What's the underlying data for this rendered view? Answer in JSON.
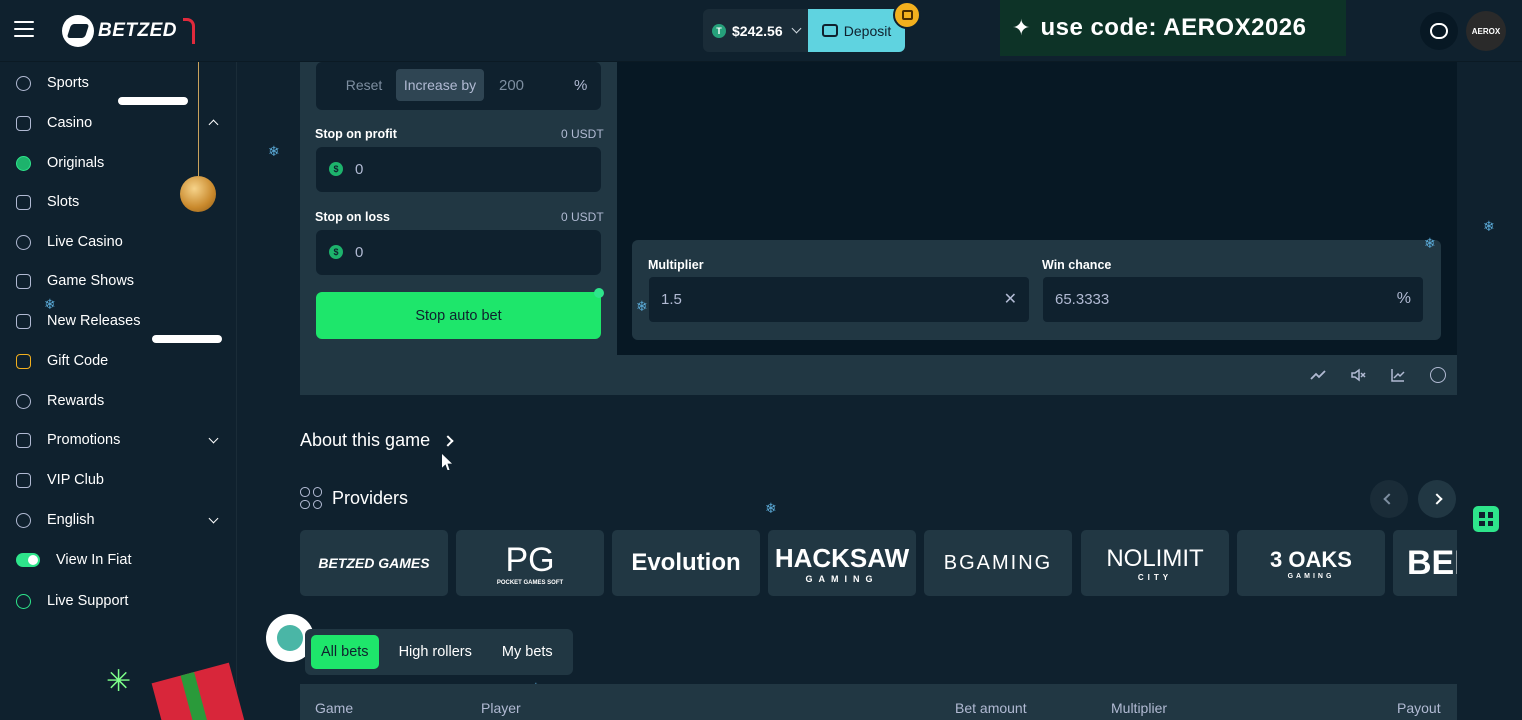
{
  "header": {
    "logo_text": "BETZED",
    "balance": "$242.56",
    "currency_icon": "T",
    "deposit_label": "Deposit",
    "promo_text": "use code: AEROX2026",
    "avatar_text": "AEROX"
  },
  "sidebar": {
    "items": [
      {
        "label": "Sports",
        "icon": "basketball-icon"
      },
      {
        "label": "Casino",
        "icon": "casino-icon"
      },
      {
        "label": "Originals",
        "icon": "originals-icon"
      },
      {
        "label": "Slots",
        "icon": "slot-machine-icon"
      },
      {
        "label": "Live Casino",
        "icon": "live-icon"
      },
      {
        "label": "Game Shows",
        "icon": "pen-icon"
      },
      {
        "label": "New Releases",
        "icon": "document-icon"
      },
      {
        "label": "Gift Code",
        "icon": "gift-icon"
      },
      {
        "label": "Rewards",
        "icon": "rewards-icon"
      },
      {
        "label": "Promotions",
        "icon": "promotions-icon"
      },
      {
        "label": "VIP Club",
        "icon": "crown-icon"
      },
      {
        "label": "English",
        "icon": "globe-icon"
      },
      {
        "label": "View In Fiat",
        "icon": "toggle-icon"
      },
      {
        "label": "Live Support",
        "icon": "headset-icon"
      }
    ]
  },
  "autobet": {
    "reset_label": "Reset",
    "increase_label": "Increase by",
    "increase_value": "200",
    "percent": "%",
    "stop_profit_label": "Stop on profit",
    "stop_profit_currency": "0 USDT",
    "stop_profit_value": "0",
    "stop_loss_label": "Stop on loss",
    "stop_loss_currency": "0 USDT",
    "stop_loss_value": "0",
    "stop_button": "Stop auto bet"
  },
  "game": {
    "multiplier_label": "Multiplier",
    "multiplier_value": "1.5",
    "win_chance_label": "Win chance",
    "win_chance_value": "65.3333",
    "percent": "%"
  },
  "about_label": "About this game",
  "providers": {
    "title": "Providers",
    "items": [
      "BETZED GAMES",
      "PG",
      "Evolution",
      "HACKSAW",
      "BGAMING",
      "NOLIMIT",
      "3 OAKS",
      "BEL"
    ],
    "subtitles": [
      "",
      "POCKET GAMES SOFT",
      "",
      "GAMING",
      "",
      "CITY",
      "GAMING",
      ""
    ]
  },
  "bets": {
    "tabs": [
      "All bets",
      "High rollers",
      "My bets"
    ],
    "columns": [
      "Game",
      "Player",
      "Bet amount",
      "Multiplier",
      "Payout"
    ]
  },
  "colors": {
    "bg": "#0f212e",
    "panel": "#213743",
    "accent_green": "#1ee66b",
    "deposit": "#5fd3e0"
  }
}
